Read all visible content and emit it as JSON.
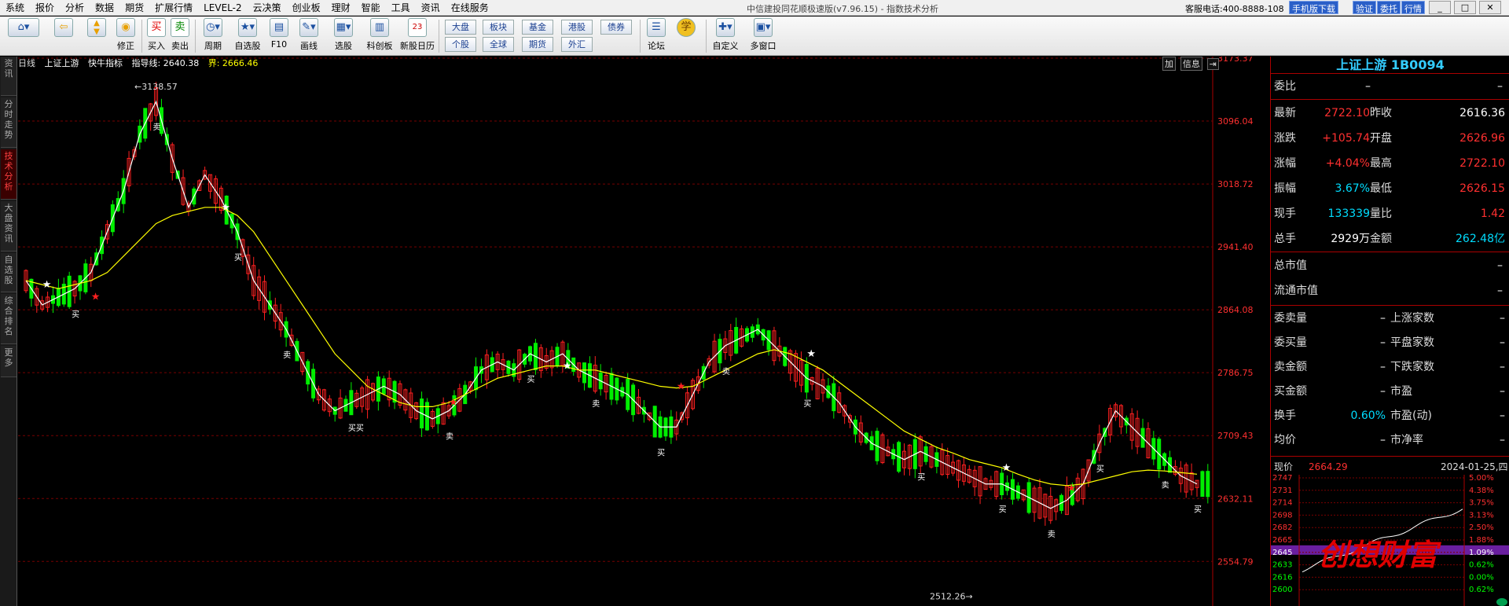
{
  "menubar": {
    "items": [
      "系统",
      "报价",
      "分析",
      "数据",
      "期货",
      "扩展行情",
      "LEVEL-2",
      "云决策",
      "创业板",
      "理财",
      "智能",
      "工具",
      "资讯",
      "在线服务"
    ],
    "window_title": "中信建投同花顺极速版(v7.96.15) - 指数技术分析",
    "hotline": "客服电话:400-8888-108",
    "buttons": [
      "手机版下载",
      "验证",
      "委托",
      "行情"
    ],
    "win_controls": [
      "_",
      "□",
      "✕"
    ]
  },
  "toolbar": {
    "buttons": [
      {
        "name": "home",
        "label": "",
        "icon": "home-icon"
      },
      {
        "name": "back",
        "label": "",
        "icon": "back-arrow-icon"
      },
      {
        "name": "updown",
        "label": "",
        "icon": "up-down-icon"
      },
      {
        "name": "fix",
        "label": "修正",
        "icon": "fix-icon"
      },
      {
        "name": "buy",
        "label": "买入",
        "icon": "买"
      },
      {
        "name": "sell",
        "label": "卖出",
        "icon": "卖"
      },
      {
        "name": "period",
        "label": "周期",
        "icon": "clock-icon"
      },
      {
        "name": "watch",
        "label": "自选股",
        "icon": "star-icon"
      },
      {
        "name": "f10",
        "label": "F10",
        "icon": "f10-icon"
      },
      {
        "name": "draw",
        "label": "画线",
        "icon": "pen-icon"
      },
      {
        "name": "select",
        "label": "选股",
        "icon": "select-icon"
      },
      {
        "name": "kechuang",
        "label": "科创板",
        "icon": "kechuang-icon"
      },
      {
        "name": "ipo",
        "label": "新股日历",
        "icon": "calendar-icon"
      },
      {
        "name": "forum",
        "label": "论坛",
        "icon": "forum-icon"
      },
      {
        "name": "learn",
        "label": "",
        "icon": "学"
      },
      {
        "name": "custom",
        "label": "自定义",
        "icon": "custom-icon"
      },
      {
        "name": "multi",
        "label": "多窗口",
        "icon": "multi-window-icon"
      }
    ],
    "small_buttons": [
      "大盘",
      "板块",
      "基金",
      "港股",
      "债券",
      "个股",
      "全球",
      "期货",
      "外汇"
    ],
    "calendar_day": "23"
  },
  "left_tabs": [
    "资讯",
    "分时走势",
    "技术分析",
    "大盘资讯",
    "自选股",
    "综合排名",
    "更多"
  ],
  "chart": {
    "header": {
      "period": "日线",
      "name": "上证上游",
      "indicator": "快牛指标",
      "guide": "指导线: 2640.38",
      "boundary": "界: 2666.46"
    },
    "buttons": [
      "加",
      "信息"
    ],
    "max_label": "3138.57",
    "min_label": "2512.26",
    "trade_labels": [
      "买",
      "卖",
      "买",
      "卖",
      "买买",
      "卖",
      "买",
      "卖",
      "买",
      "卖",
      "买",
      "买",
      "买",
      "卖",
      "买",
      "卖",
      "买"
    ],
    "y_ticks": [
      "3173.37",
      "3096.04",
      "3018.72",
      "2941.40",
      "2864.08",
      "2786.75",
      "2709.43",
      "2632.11",
      "2554.79"
    ]
  },
  "chart_data": {
    "type": "line",
    "title": "",
    "ylim": [
      2500,
      3173.37
    ],
    "y_ticks": [
      3173.37,
      3096.04,
      3018.72,
      2941.4,
      2864.08,
      2786.75,
      2709.43,
      2632.11,
      2554.79
    ],
    "grid": true,
    "series": [
      {
        "name": "",
        "values": [
          2900,
          2870,
          2880,
          2890,
          2910,
          2960,
          3010,
          3080,
          3120,
          3050,
          2990,
          3030,
          3000,
          2960,
          2900,
          2870,
          2840,
          2800,
          2760,
          2740,
          2750,
          2760,
          2770,
          2760,
          2740,
          2730,
          2740,
          2760,
          2790,
          2800,
          2790,
          2810,
          2800,
          2810,
          2790,
          2780,
          2770,
          2760,
          2740,
          2720,
          2720,
          2760,
          2800,
          2820,
          2830,
          2840,
          2820,
          2800,
          2780,
          2770,
          2750,
          2720,
          2700,
          2690,
          2680,
          2690,
          2680,
          2670,
          2660,
          2650,
          2650,
          2640,
          2630,
          2620,
          2630,
          2650,
          2700,
          2740,
          2720,
          2700,
          2680,
          2660,
          2650
        ]
      },
      {
        "name": "",
        "values": [
          2900,
          2895,
          2890,
          2895,
          2900,
          2910,
          2930,
          2950,
          2970,
          2980,
          2985,
          2990,
          2990,
          2980,
          2960,
          2930,
          2900,
          2870,
          2840,
          2810,
          2790,
          2770,
          2760,
          2750,
          2745,
          2745,
          2750,
          2760,
          2770,
          2780,
          2785,
          2790,
          2795,
          2795,
          2790,
          2790,
          2785,
          2780,
          2775,
          2770,
          2768,
          2770,
          2780,
          2790,
          2800,
          2810,
          2815,
          2810,
          2800,
          2790,
          2775,
          2760,
          2745,
          2730,
          2715,
          2705,
          2695,
          2688,
          2680,
          2675,
          2670,
          2662,
          2655,
          2650,
          2648,
          2650,
          2655,
          2660,
          2665,
          2667,
          2666,
          2664,
          2662
        ]
      }
    ]
  },
  "panel": {
    "title": "上证上游 1B0094",
    "weibi_label": "委比",
    "weibi_value": "–",
    "weibi_value2": "–",
    "rows": [
      {
        "l1": "最新",
        "v1": "2722.10",
        "l2": "昨收",
        "v2": "2616.36",
        "c1": "red",
        "c2": "white"
      },
      {
        "l1": "涨跌",
        "v1": "+105.74",
        "l2": "开盘",
        "v2": "2626.96",
        "c1": "red",
        "c2": "red"
      },
      {
        "l1": "涨幅",
        "v1": "+4.04%",
        "l2": "最高",
        "v2": "2722.10",
        "c1": "red",
        "c2": "red"
      },
      {
        "l1": "振幅",
        "v1": "3.67%",
        "l2": "最低",
        "v2": "2626.15",
        "c1": "cyan",
        "c2": "red"
      },
      {
        "l1": "现手",
        "v1": "133339",
        "l2": "量比",
        "v2": "1.42",
        "c1": "cyan",
        "c2": "red"
      },
      {
        "l1": "总手",
        "v1": "2929万",
        "l2": "金额",
        "v2": "262.48亿",
        "c1": "white",
        "c2": "cyan"
      }
    ],
    "market_cap": "总市值",
    "market_cap_v": "–",
    "float_cap": "流通市值",
    "float_cap_v": "–",
    "stats": [
      {
        "l1": "委卖量",
        "v1": "–",
        "l2": "上涨家数",
        "v2": "–"
      },
      {
        "l1": "委买量",
        "v1": "–",
        "l2": "平盘家数",
        "v2": "–"
      },
      {
        "l1": "卖金额",
        "v1": "–",
        "l2": "下跌家数",
        "v2": "–"
      },
      {
        "l1": "买金额",
        "v1": "–",
        "l2": "市盈",
        "v2": "–"
      },
      {
        "l1": "换手",
        "v1": "0.60%",
        "l2": "市盈(动)",
        "v2": "–"
      },
      {
        "l1": "均价",
        "v1": "–",
        "l2": "市净率",
        "v2": "–"
      }
    ],
    "mini": {
      "label": "现价",
      "price": "2664.29",
      "date": "2024-01-25,四",
      "left_ticks": [
        "2747",
        "2731",
        "2714",
        "2698",
        "2682",
        "2665",
        "2645",
        "2633",
        "2616",
        "2600"
      ],
      "right_ticks": [
        "5.00%",
        "4.38%",
        "3.75%",
        "3.13%",
        "2.50%",
        "1.88%",
        "1.09%",
        "0.62%",
        "0.00%",
        "0.62%"
      ],
      "watermark": "创想财富"
    }
  }
}
